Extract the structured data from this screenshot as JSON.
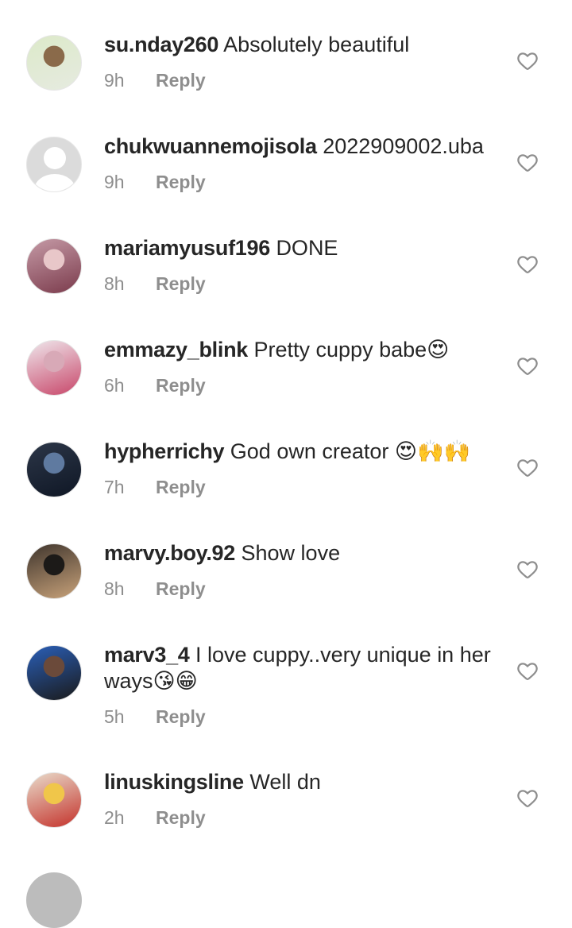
{
  "comments": [
    {
      "username": "su.nday260",
      "text": "Absolutely beautiful",
      "time": "9h",
      "reply": "Reply",
      "avatar": {
        "type": "photo",
        "colors": [
          "#dce9c9",
          "#e6ebe0",
          "#8a6a4a"
        ]
      }
    },
    {
      "username": "chukwuannemojisola",
      "text": "2022909002.uba",
      "time": "9h",
      "reply": "Reply",
      "avatar": {
        "type": "default"
      }
    },
    {
      "username": "mariamyusuf196",
      "text": "DONE",
      "time": "8h",
      "reply": "Reply",
      "avatar": {
        "type": "photo",
        "colors": [
          "#c59aa6",
          "#7b3b4c",
          "#e8c7c9"
        ]
      }
    },
    {
      "username": "emmazy_blink",
      "text": "Pretty cuppy babe😍",
      "time": "6h",
      "reply": "Reply",
      "avatar": {
        "type": "photo",
        "colors": [
          "#efe7ec",
          "#c8476a",
          "#d8a9b7"
        ]
      }
    },
    {
      "username": "hypherrichy",
      "text": "God own creator 😍🙌🙌",
      "time": "7h",
      "reply": "Reply",
      "avatar": {
        "type": "photo",
        "colors": [
          "#2c3648",
          "#0f1725",
          "#5f7aa0"
        ]
      }
    },
    {
      "username": "marvy.boy.92",
      "text": "Show love",
      "time": "8h",
      "reply": "Reply",
      "avatar": {
        "type": "photo",
        "colors": [
          "#3f352d",
          "#c8a27a",
          "#1c1a18"
        ]
      }
    },
    {
      "username": "marv3_4",
      "text": "I love cuppy..very unique in her ways😘😁",
      "time": "5h",
      "reply": "Reply",
      "avatar": {
        "type": "photo",
        "colors": [
          "#2a5fb8",
          "#1a1a1a",
          "#6b4a3a"
        ]
      }
    },
    {
      "username": "linuskingsline",
      "text": "Well dn",
      "time": "2h",
      "reply": "Reply",
      "avatar": {
        "type": "photo",
        "colors": [
          "#e9dccb",
          "#c4322b",
          "#f0c64a"
        ]
      }
    }
  ],
  "like_icon": "heart-outline-icon",
  "colors": {
    "text": "#262626",
    "secondary": "#8e8e8e",
    "background": "#ffffff"
  }
}
